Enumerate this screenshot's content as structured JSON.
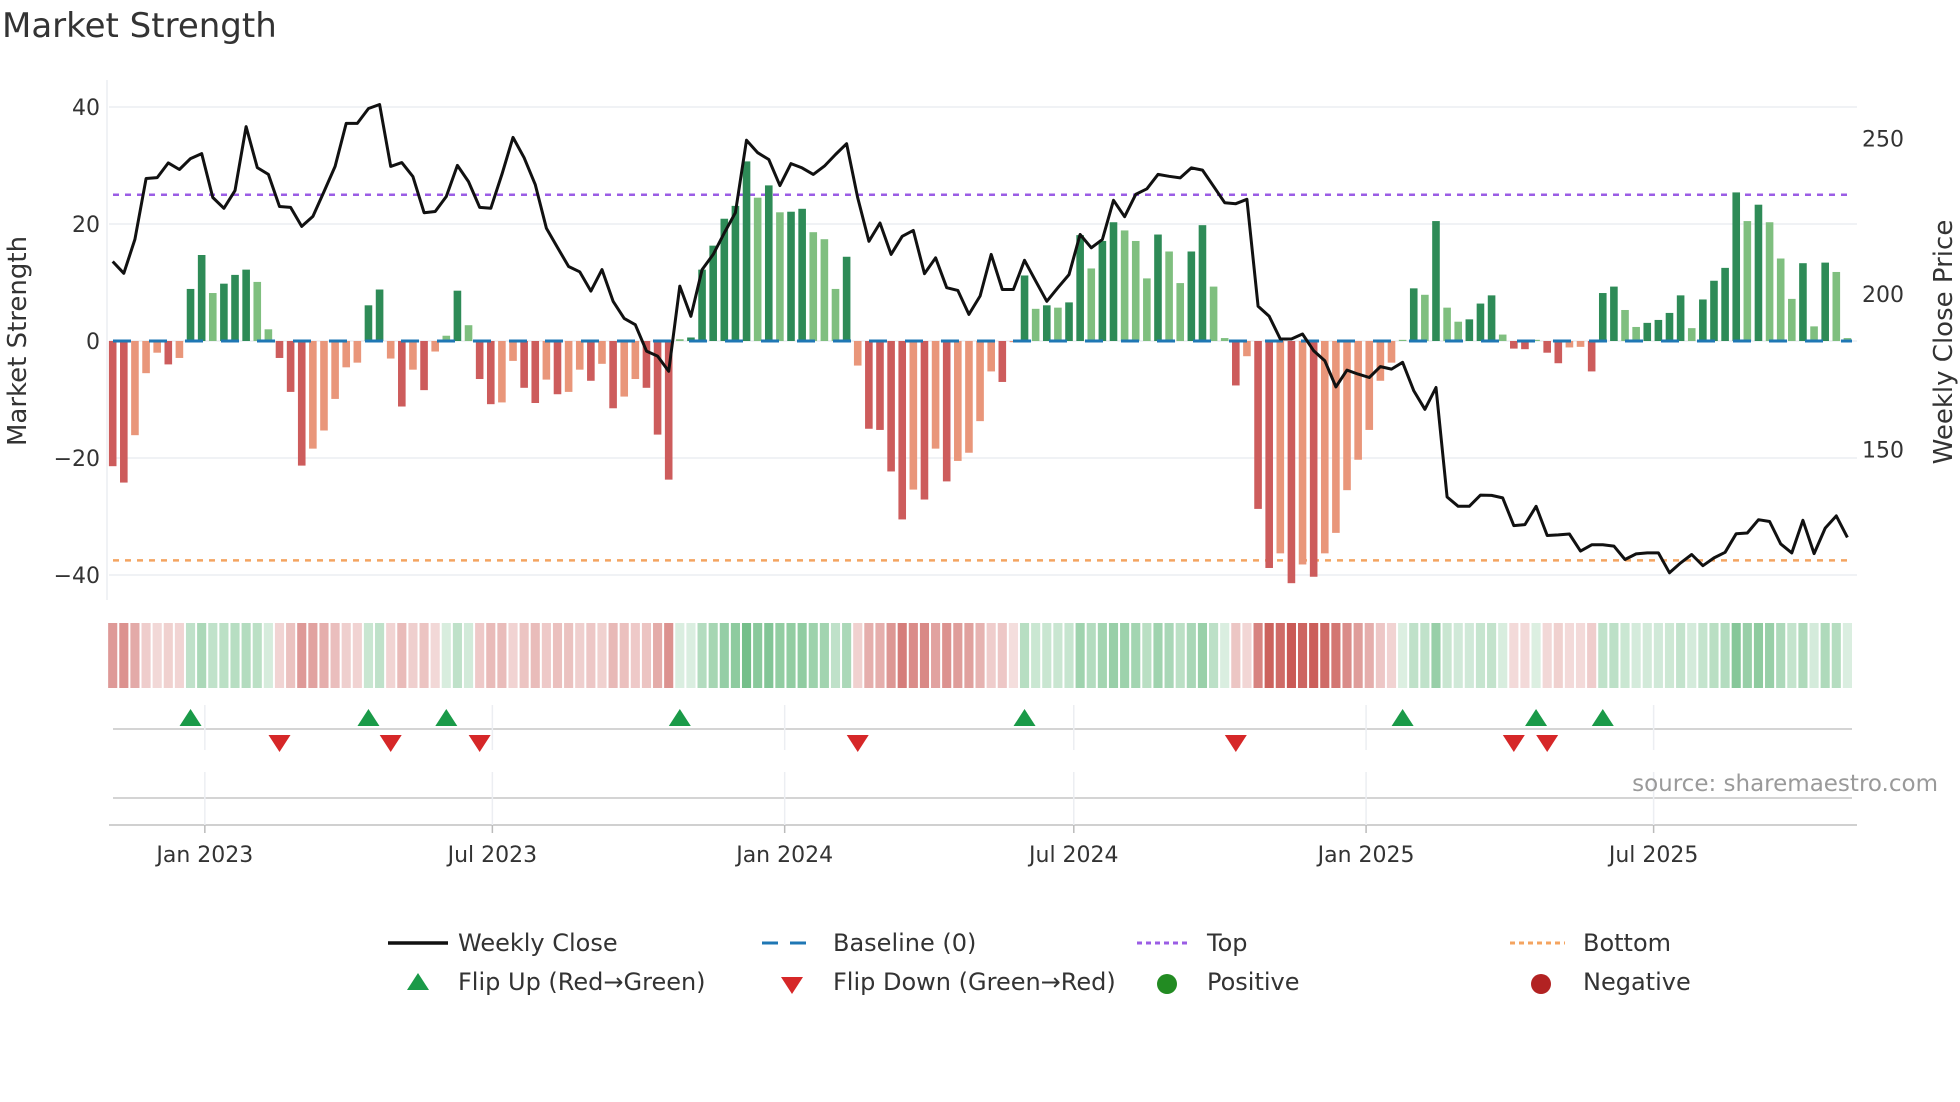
{
  "title": "Market Strength",
  "source": "source: sharemaestro.com",
  "legend": {
    "weekly_close": "Weekly Close",
    "baseline": "Baseline (0)",
    "top": "Top",
    "bottom": "Bottom",
    "flip_up": "Flip Up (Red→Green)",
    "flip_down": "Flip Down (Green→Red)",
    "positive": "Positive",
    "negative": "Negative"
  },
  "colors": {
    "strong_up": "#2e8b57",
    "weak_up": "#7fbf7f",
    "strong_down": "#cd5c5c",
    "weak_down": "#e9967a",
    "baseline": "#1f77b4",
    "top": "#9b5de5",
    "bottom": "#f4a460",
    "flip_up": "#1a9a48",
    "flip_down": "#d62728",
    "positive": "#228b22",
    "negative": "#b22222",
    "price": "#111111"
  },
  "chart_data": {
    "type": "bar",
    "title": "Market Strength",
    "ylabel": "Market Strength",
    "y2label": "Weekly Close Price",
    "ylim": [
      -45,
      42
    ],
    "y2_ticks": [
      "250",
      "200",
      "150"
    ],
    "y_ticks": [
      "40",
      "20",
      "0",
      "−20",
      "−40"
    ],
    "y_tick_values": [
      40,
      20,
      0,
      -20,
      -40
    ],
    "y2_tick_values": [
      250,
      200,
      150
    ],
    "x_start": "2022-11-04",
    "x_step_days": 7,
    "x_ticks": [
      {
        "label": "Jan 2023",
        "date": "2023-01-01"
      },
      {
        "label": "Jul 2023",
        "date": "2023-07-01"
      },
      {
        "label": "Jan 2024",
        "date": "2024-01-01"
      },
      {
        "label": "Jul 2024",
        "date": "2024-07-01"
      },
      {
        "label": "Jan 2025",
        "date": "2025-01-01"
      },
      {
        "label": "Jul 2025",
        "date": "2025-07-01"
      }
    ],
    "top_level": 25,
    "bottom_level": -37.5,
    "baseline": 0,
    "grid": true,
    "legend_position": "bottom",
    "strength": [
      -21.4,
      -24.2,
      -16.1,
      -5.5,
      -2,
      -4,
      -2.9,
      8.9,
      14.7,
      8.2,
      9.8,
      11.3,
      12.2,
      10.1,
      2,
      -2.9,
      -8.7,
      -21.3,
      -18.4,
      -15.3,
      -9.9,
      -4.5,
      -3.7,
      6.1,
      8.8,
      -3,
      -11.2,
      -4.9,
      -8.4,
      -1.8,
      0.9,
      8.6,
      2.7,
      -6.5,
      -10.8,
      -10.5,
      -3.4,
      -8,
      -10.6,
      -6.6,
      -9.1,
      -8.7,
      -4.9,
      -6.8,
      -3.9,
      -11.5,
      -9.5,
      -6.5,
      -8,
      -16,
      -23.7,
      0.3,
      0.6,
      12.2,
      16.3,
      20.9,
      23.1,
      30.7,
      24.5,
      26.6,
      22,
      22.1,
      22.6,
      18.6,
      17.4,
      8.9,
      14.4,
      -4.2,
      -15,
      -15.2,
      -22.3,
      -30.5,
      -25.4,
      -27.1,
      -18.4,
      -24,
      -20.5,
      -19.1,
      -13.7,
      -5.2,
      -7,
      -0.2,
      11.2,
      5.5,
      6.1,
      5.7,
      6.6,
      18.1,
      12.4,
      17.1,
      20.3,
      18.9,
      17.1,
      10.7,
      18.2,
      15.3,
      9.9,
      15.3,
      19.8,
      9.3,
      0.5,
      -7.6,
      -2.6,
      -28.7,
      -38.8,
      -36.3,
      -41.4,
      -38.2,
      -40.3,
      -36.3,
      -32.8,
      -25.5,
      -20.3,
      -15.2,
      -6.8,
      -3.7,
      0.2,
      9,
      7.9,
      20.5,
      5.7,
      3.3,
      3.7,
      6.4,
      7.8,
      1.1,
      -1.3,
      -1.4,
      0.2,
      -2,
      -3.8,
      -1.1,
      -1,
      -5.2,
      8.2,
      9.3,
      5.3,
      2.4,
      3.1,
      3.6,
      4.8,
      7.8,
      2.2,
      7.1,
      10.3,
      12.5,
      25.4,
      20.5,
      23.3,
      20.3,
      14.1,
      7.2,
      13.3,
      2.5,
      13.4,
      11.8,
      0.5
    ],
    "weekly_close": [
      214.3,
      210.5,
      221.4,
      241,
      241.3,
      246,
      243.9,
      247.4,
      249,
      234.9,
      231.4,
      237.1,
      257.7,
      244.5,
      242.3,
      232,
      231.7,
      225.6,
      228.8,
      236.8,
      244.9,
      258.7,
      258.7,
      263.5,
      264.8,
      244.9,
      246.1,
      241.6,
      230,
      230.4,
      235.2,
      245.2,
      240,
      231.7,
      231.4,
      242.3,
      254.2,
      247.7,
      239,
      225,
      218.8,
      212.7,
      211,
      204.8,
      211.7,
      201.5,
      196,
      194,
      185.5,
      183.9,
      179,
      206.4,
      196.7,
      211.7,
      216.6,
      223.5,
      230,
      253.3,
      249.3,
      247.1,
      238.7,
      245.8,
      244.4,
      242.3,
      245,
      248.7,
      252.2,
      234.8,
      220.8,
      226.7,
      216.6,
      222.4,
      224.3,
      210.4,
      215.5,
      205.9,
      205,
      197.3,
      203.2,
      216.6,
      205.3,
      205.3,
      214.7,
      208,
      201.5,
      205.9,
      210.1,
      223,
      218.7,
      221.4,
      234,
      228.7,
      235.9,
      237.7,
      242.3,
      241.7,
      241.2,
      244.4,
      243.7,
      238.5,
      233.2,
      232.9,
      234.3,
      199.9,
      196.7,
      189.4,
      189.4,
      191,
      185.6,
      182.4,
      174,
      179.4,
      178.1,
      177,
      180.5,
      179.7,
      181.9,
      172.8,
      166.8,
      173.8,
      138.6,
      135.6,
      135.6,
      139.2,
      139.1,
      138.3,
      129.4,
      129.7,
      135.6,
      126.2,
      126.4,
      126.7,
      121.2,
      123.2,
      123.2,
      122.8,
      118.5,
      120.3,
      120.6,
      120.6,
      114.2,
      117.4,
      120.1,
      116.5,
      119,
      120.8,
      126.8,
      127,
      131.3,
      130.7,
      123.5,
      120.6,
      131.1,
      120.4,
      128.6,
      132.5,
      125.6
    ],
    "flip_up_weeks": [
      8,
      24,
      31,
      52,
      83,
      117,
      129,
      135
    ],
    "flip_down_weeks": [
      16,
      26,
      34,
      68,
      102,
      127,
      130
    ]
  }
}
